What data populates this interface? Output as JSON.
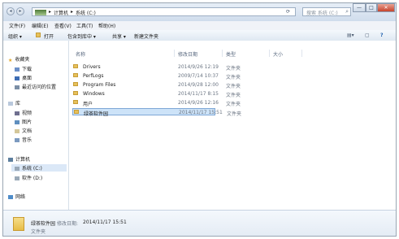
{
  "window": {
    "address_parts": [
      "计算机",
      "系统 (C:)"
    ],
    "address_separator": "▸",
    "search_placeholder": "搜索 系统 (C:)",
    "controls": [
      "—",
      "□",
      "✕"
    ]
  },
  "menubar": [
    "文件(F)",
    "编辑(E)",
    "查看(V)",
    "工具(T)",
    "帮助(H)"
  ],
  "toolbar": {
    "organize": "组织 ▾",
    "open": "打开",
    "include": "包含到库中 ▾",
    "share": "共享 ▾",
    "new_folder": "新建文件夹"
  },
  "sidebar": {
    "favorites": "收藏夹",
    "downloads": "下载",
    "desktop": "桌面",
    "recent": "最近访问的位置",
    "libraries": "库",
    "videos": "视频",
    "pictures": "图片",
    "documents": "文档",
    "music": "音乐",
    "computer": "计算机",
    "drive_c": "系统 (C:)",
    "drive_d": "软件 (D:)",
    "network": "网络"
  },
  "columns": {
    "name": "名称",
    "modified": "修改日期",
    "type": "类型",
    "size": "大小"
  },
  "files": [
    {
      "name": "Drivers",
      "date": "2014/9/26 12:19",
      "type": "文件夹"
    },
    {
      "name": "PerfLogs",
      "date": "2009/7/14 10:37",
      "type": "文件夹"
    },
    {
      "name": "Program Files",
      "date": "2014/9/28 12:00",
      "type": "文件夹"
    },
    {
      "name": "Windows",
      "date": "2014/11/17 8:15",
      "type": "文件夹"
    },
    {
      "name": "用户",
      "date": "2014/9/26 12:16",
      "type": "文件夹"
    },
    {
      "name": "绿茶软件园",
      "date": "2014/11/17 15:51",
      "type": "文件夹"
    }
  ],
  "details": {
    "name": "绿茶软件园",
    "modified_label": "修改日期:",
    "modified_value": "2014/11/17 15:51",
    "type": "文件夹"
  }
}
